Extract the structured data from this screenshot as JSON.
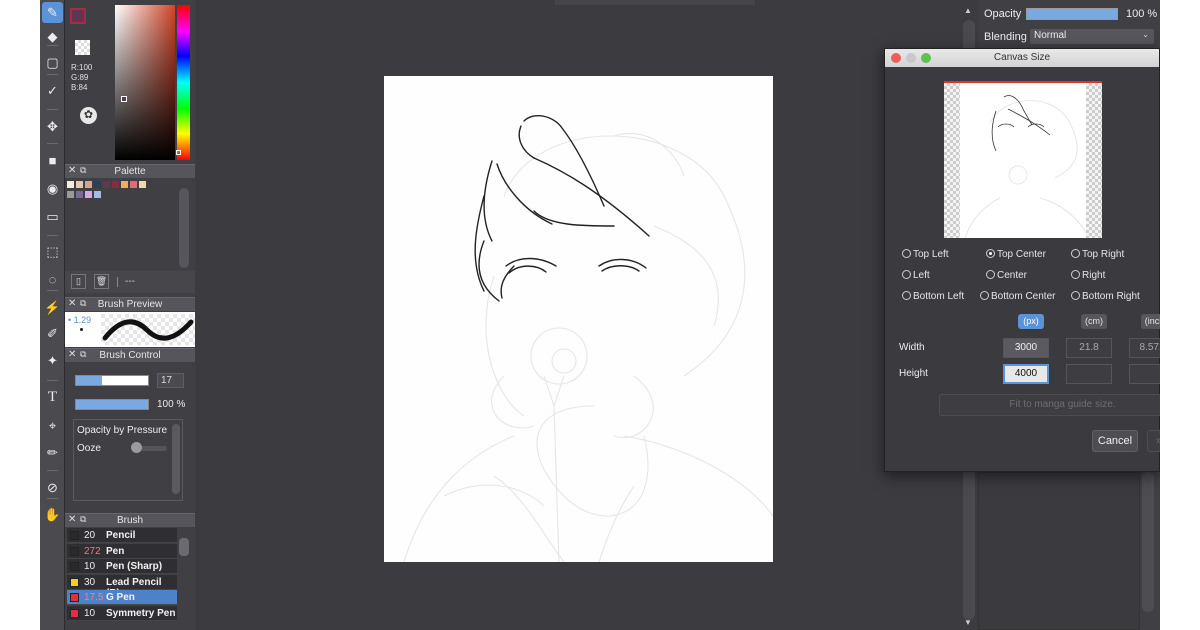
{
  "colors": {
    "accent": "#5c92d6",
    "canvas_bg": "#3b3b40",
    "panel_bg": "#3f3f44",
    "current_color": "#643354"
  },
  "toolbar": {
    "tools": [
      "brush-icon",
      "eraser-icon",
      "shape-icon",
      "select-pen-icon",
      "move-icon",
      "fill-rect-icon",
      "bucket-icon",
      "gradient-icon",
      "marquee-icon",
      "lasso-icon",
      "magic-wand-icon",
      "select-eraser-icon",
      "select-fill-icon",
      "text-icon",
      "operation-icon",
      "eyedropper-pen-icon",
      "eyedropper-icon",
      "hand-icon"
    ]
  },
  "color_picker": {
    "r": "R:100",
    "g": "G:89",
    "b": "B:84"
  },
  "palette": {
    "title": "Palette",
    "swatches": [
      "#f2eee6",
      "#e8c8b0",
      "#d8a48a",
      "#2d3f55",
      "#5c3a50",
      "#8a2a3c",
      "#e8b060",
      "#e06a7a",
      "#f0d8a8",
      "#9a9a9a",
      "#7a6a9a",
      "#d8a8e0",
      "#a8b8e8"
    ],
    "footer_text": "---"
  },
  "brush_preview": {
    "title": "Brush Preview",
    "size_label": "1.29"
  },
  "brush_control": {
    "title": "Brush Control",
    "size_value": "17",
    "opacity_value": "100 %",
    "opacity_by_pressure": "Opacity by Pressure",
    "ooze": "Ooze"
  },
  "brush_list": {
    "title": "Brush",
    "items": [
      {
        "color": "#2a2a2a",
        "size": "20",
        "name": "Pencil",
        "size_color": "#eeeeee"
      },
      {
        "color": "#2a2a2a",
        "size": "272",
        "name": "Pen",
        "size_color": "#e87a8a"
      },
      {
        "color": "#2a2a2a",
        "size": "10",
        "name": "Pen (Sharp)",
        "size_color": "#eeeeee"
      },
      {
        "color": "#f0d020",
        "size": "30",
        "name": "Lead Pencil (B)",
        "size_color": "#eeeeee"
      },
      {
        "color": "#e03040",
        "size": "17.5",
        "name": "G Pen",
        "size_color": "#f48080",
        "selected": true
      },
      {
        "color": "#e03040",
        "size": "10",
        "name": "Symmetry Pen",
        "size_color": "#eeeeee"
      }
    ]
  },
  "layers": {
    "opacity_label": "Opacity",
    "opacity_value": "100 %",
    "blending_label": "Blending",
    "blending_value": "Normal"
  },
  "dialog": {
    "title": "Canvas Size",
    "anchors": [
      {
        "label": "Top Left",
        "on": false
      },
      {
        "label": "Top Center",
        "on": true
      },
      {
        "label": "Top Right",
        "on": false
      },
      {
        "label": "Left",
        "on": false
      },
      {
        "label": "Center",
        "on": false
      },
      {
        "label": "Right",
        "on": false
      },
      {
        "label": "Bottom Left",
        "on": false
      },
      {
        "label": "Bottom Center",
        "on": false
      },
      {
        "label": "Bottom Right",
        "on": false
      }
    ],
    "units": [
      "(px)",
      "(cm)",
      "(inch)"
    ],
    "active_unit": "(px)",
    "width_label": "Width",
    "height_label": "Height",
    "width_px": "3000",
    "width_cm": "21.8",
    "width_inch": "8.571",
    "height_px": "4000",
    "fit_button": "Fit to manga guide size.",
    "cancel_button": "Cancel",
    "ok_button": "»"
  }
}
